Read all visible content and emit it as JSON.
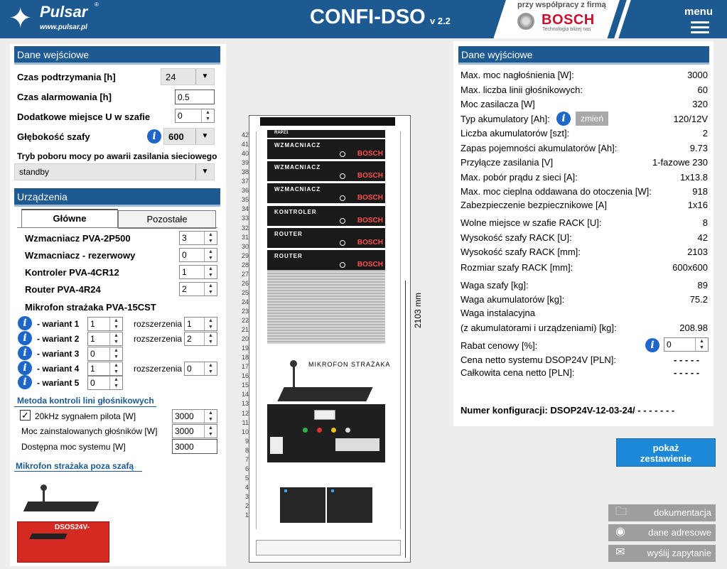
{
  "header": {
    "logo_brand": "Pulsar",
    "logo_reg": "®",
    "logo_url": "www.pulsar.pl",
    "app_title": "CONFI-DSO",
    "app_version": "v 2.2",
    "coop_text": "przy współpracy z firmą",
    "bosch_name": "BOSCH",
    "bosch_tagline": "Technologia bliżej nas",
    "menu_label": "menu"
  },
  "input": {
    "title": "Dane wejściowe",
    "backup_time_label": "Czas podtrzymania [h]",
    "backup_time_value": "24",
    "alarm_time_label": "Czas alarmowania [h]",
    "alarm_time_value": "0.5",
    "extra_u_label": "Dodatkowe miejsce U w szafie",
    "extra_u_value": "0",
    "depth_label": "Głębokość szafy",
    "depth_value": "600",
    "mode_label": "Tryb poboru mocy po awarii zasilania sieciowego",
    "mode_value": "standby"
  },
  "devices": {
    "title": "Urządzenia",
    "tab_main": "Główne",
    "tab_other": "Pozostałe",
    "items": [
      {
        "label": "Wzmacniacz PVA-2P500",
        "value": "3"
      },
      {
        "label": "Wzmacniacz - rezerwowy",
        "value": "0"
      },
      {
        "label": "Kontroler PVA-4CR12",
        "value": "1"
      },
      {
        "label": "Router PVA-4R24",
        "value": "2"
      }
    ],
    "mic_label": "Mikrofon strażaka PVA-15CST",
    "variants": [
      {
        "label": "- wariant 1",
        "value": "1",
        "ext_label": "rozszerzenia",
        "ext_value": "1"
      },
      {
        "label": "- wariant 2",
        "value": "1",
        "ext_label": "rozszerzenia",
        "ext_value": "2"
      },
      {
        "label": "- wariant 3",
        "value": "0"
      },
      {
        "label": "- wariant 4",
        "value": "1",
        "ext_label": "rozszerzenia",
        "ext_value": "0"
      },
      {
        "label": "- wariant 5",
        "value": "0"
      }
    ],
    "method_title": "Metoda kontroli lini głośnikowych",
    "pilot_label": "20kHz sygnałem pilota [W]",
    "pilot_checked": "✓",
    "pilot_value": "3000",
    "installed_label": "Moc zainstalowanych głośników [W]",
    "installed_value": "3000",
    "available_label": "Dostępna moc systemu [W]",
    "available_value": "3000",
    "remote_mic_title": "Mikrofon strażaka poza szafą",
    "remote_mic_caption": "DSOS24V-"
  },
  "rack": {
    "units": [
      "42",
      "41",
      "40",
      "39",
      "38",
      "37",
      "36",
      "35",
      "34",
      "33",
      "32",
      "31",
      "30",
      "29",
      "28",
      "27",
      "26",
      "25",
      "24",
      "23",
      "22",
      "21",
      "20",
      "19",
      "18",
      "17",
      "16",
      "15",
      "14",
      "13",
      "12",
      "11",
      "10",
      "9",
      "8",
      "7",
      "6",
      "5",
      "4",
      "3",
      "2",
      "1"
    ],
    "top_label": "RAPZ1",
    "devices": [
      {
        "name": "WZMACNIACZ",
        "brand": "BOSCH"
      },
      {
        "name": "WZMACNIACZ",
        "brand": "BOSCH"
      },
      {
        "name": "WZMACNIACZ",
        "brand": "BOSCH"
      },
      {
        "name": "KONTROLER",
        "brand": "BOSCH"
      },
      {
        "name": "ROUTER",
        "brand": "BOSCH"
      },
      {
        "name": "ROUTER",
        "brand": "BOSCH"
      }
    ],
    "mic_label": "MIKROFON STRAŻAKA",
    "height_text": "2103 mm"
  },
  "output": {
    "title": "Dane wyjściowe",
    "rows": [
      {
        "k": "Max. moc nagłośnienia [W]:",
        "v": "3000"
      },
      {
        "k": "Max. liczba linii głośnikowych:",
        "v": "60"
      },
      {
        "k": "Moc zasilacza [W]",
        "v": "320"
      },
      {
        "k": "Typ akumulatory [Ah]:",
        "v": "120/12V"
      },
      {
        "k": "Liczba akumulatorów [szt]:",
        "v": "2"
      },
      {
        "k": "Zapas pojemności akumulatorów [Ah]:",
        "v": "9.73"
      },
      {
        "k": "Przyłącze zasilania [V]",
        "v": "1-fazowe 230"
      },
      {
        "k": "Max. pobór prądu z sieci [A]:",
        "v": "1x13.8"
      },
      {
        "k": "Max. moc cieplna oddawana do otoczenia [W]:",
        "v": "918"
      },
      {
        "k": "Zabezpieczenie bezpiecznikowe [A]",
        "v": "1x16"
      },
      {
        "k": "Wolne miejsce w szafie RACK [U]:",
        "v": "8"
      },
      {
        "k": "Wysokość szafy RACK [U]:",
        "v": "42"
      },
      {
        "k": "Wysokość szafy RACK [mm]:",
        "v": "2103"
      },
      {
        "k": "Rozmiar szafy RACK [mm]:",
        "v": "600x600"
      },
      {
        "k": "Waga szafy [kg]:",
        "v": "89"
      },
      {
        "k": "Waga akumulatorów [kg]:",
        "v": "75.2"
      },
      {
        "k": "Waga instalacyjna",
        "v": ""
      },
      {
        "k": "(z akumulatorami i urządzeniami) [kg]:",
        "v": "208.98"
      }
    ],
    "change_btn": "zmień",
    "discount_label": "Rabat cenowy  [%]:",
    "discount_value": "0",
    "net_system_label": "Cena netto systemu DSOP24V [PLN]:",
    "net_system_value": "- - - - -",
    "net_total_label": "Całkowita cena netto [PLN]:",
    "net_total_value": "- - - - -",
    "config_label": "Numer konfiguracji: DSOP24V-12-03-24/ - - - - - - -"
  },
  "actions": {
    "show_line1": "pokaż",
    "show_line2": "zestawienie",
    "docs": "dokumentacja",
    "address": "dane adresowe",
    "send": "wyślij zapytanie"
  },
  "colors": {
    "header": "#1d5a92",
    "info": "#1e66c8",
    "bosch": "#c8102e",
    "show_btn": "#1e88d8"
  }
}
